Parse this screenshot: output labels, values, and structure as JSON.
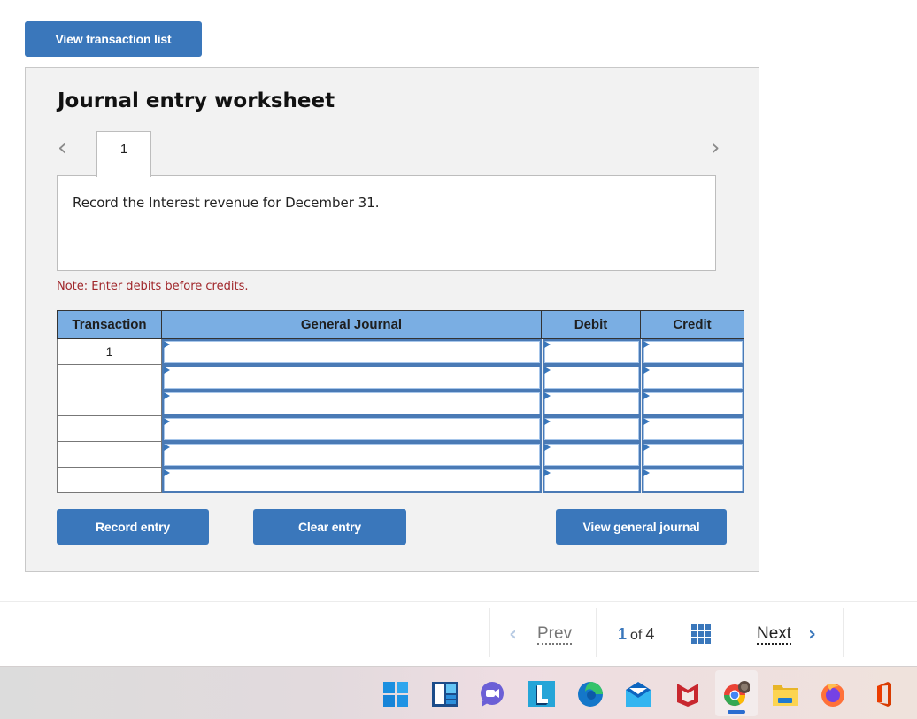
{
  "top_button": {
    "label": "View transaction list"
  },
  "worksheet": {
    "title": "Journal entry worksheet",
    "prev_icon": "chevron-left-icon",
    "next_icon": "chevron-right-icon",
    "tabs": [
      {
        "label": "1"
      }
    ],
    "description": "Record the Interest revenue for December 31.",
    "note": "Note: Enter debits before credits.",
    "table": {
      "headers": [
        "Transaction",
        "General Journal",
        "Debit",
        "Credit"
      ],
      "rows": [
        {
          "transaction": "1",
          "account": "",
          "debit": "",
          "credit": ""
        },
        {
          "transaction": "",
          "account": "",
          "debit": "",
          "credit": ""
        },
        {
          "transaction": "",
          "account": "",
          "debit": "",
          "credit": ""
        },
        {
          "transaction": "",
          "account": "",
          "debit": "",
          "credit": ""
        },
        {
          "transaction": "",
          "account": "",
          "debit": "",
          "credit": ""
        },
        {
          "transaction": "",
          "account": "",
          "debit": "",
          "credit": ""
        }
      ]
    },
    "buttons": {
      "record": "Record entry",
      "clear": "Clear entry",
      "view_journal": "View general journal"
    }
  },
  "pager": {
    "prev_label": "Prev",
    "current": "1",
    "of_label": "of",
    "total": "4",
    "next_label": "Next",
    "grid_icon": "grid-icon"
  },
  "taskbar": {
    "icons": [
      "windows-start-icon",
      "widgets-icon",
      "teams-chat-icon",
      "launcher-l-icon",
      "edge-icon",
      "mail-icon",
      "mcafee-icon",
      "chrome-icon",
      "file-explorer-icon",
      "firefox-icon",
      "office-icon"
    ],
    "active": "chrome-icon"
  },
  "colors": {
    "accent": "#3a77bb",
    "header_fill": "#7aaee3",
    "note_red": "#a0262a",
    "panel_bg": "#f2f2f2"
  }
}
